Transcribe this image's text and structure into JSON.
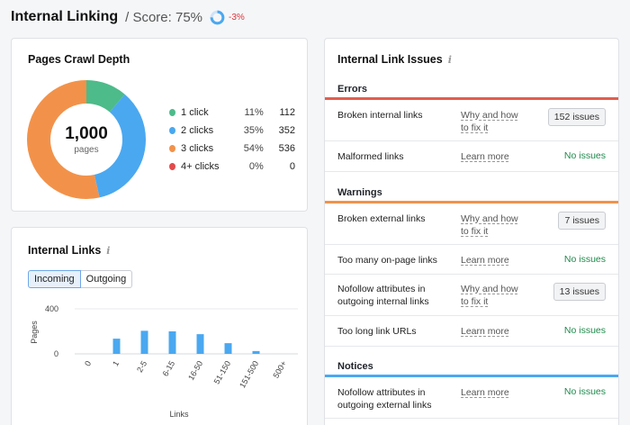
{
  "header": {
    "title": "Internal Linking",
    "score_text": "/ Score: 75%",
    "score_value": 75,
    "delta": "-3%"
  },
  "crawl_depth": {
    "title": "Pages Crawl Depth",
    "total": "1,000",
    "total_label": "pages",
    "legend": [
      {
        "label": "1 click",
        "pct": "11%",
        "count": "112",
        "color": "#4dbb8a",
        "value": 112
      },
      {
        "label": "2 clicks",
        "pct": "35%",
        "count": "352",
        "color": "#4aa8f0",
        "value": 352
      },
      {
        "label": "3 clicks",
        "pct": "54%",
        "count": "536",
        "color": "#f2924a",
        "value": 536
      },
      {
        "label": "4+ clicks",
        "pct": "0%",
        "count": "0",
        "color": "#e24b4b",
        "value": 0
      }
    ]
  },
  "internal_links": {
    "title": "Internal Links",
    "tabs": {
      "incoming": "Incoming",
      "outgoing": "Outgoing"
    },
    "chart_data": {
      "type": "bar",
      "categories": [
        "0",
        "1",
        "2-5",
        "6-15",
        "16-50",
        "51-150",
        "151-500",
        "500+"
      ],
      "values": [
        0,
        135,
        205,
        200,
        175,
        95,
        25,
        0
      ],
      "xlabel": "Links",
      "ylabel": "Pages",
      "ylim": [
        0,
        400
      ],
      "yticks": [
        "0",
        "400"
      ],
      "color": "#4aa8f0"
    }
  },
  "issues": {
    "title": "Internal Link Issues",
    "sections": [
      {
        "name": "Errors",
        "color": "#e35d4f"
      },
      {
        "name": "Warnings",
        "color": "#f2924a"
      },
      {
        "name": "Notices",
        "color": "#4aa8f0"
      }
    ],
    "rows": [
      {
        "name": "Broken internal links",
        "link": "Why and how to fix it",
        "status": "152 issues"
      },
      {
        "name": "Malformed links",
        "link": "Learn more",
        "status": "No issues"
      },
      {
        "name": "Broken external links",
        "link": "Why and how to fix it",
        "status": "7 issues"
      },
      {
        "name": "Too many on-page links",
        "link": "Learn more",
        "status": "No issues"
      },
      {
        "name": "Nofollow attributes in outgoing internal links",
        "link": "Why and how to fix it",
        "status": "13 issues"
      },
      {
        "name": "Too long link URLs",
        "link": "Learn more",
        "status": "No issues"
      },
      {
        "name": "Nofollow attributes in outgoing external links",
        "link": "Learn more",
        "status": "No issues"
      }
    ]
  }
}
